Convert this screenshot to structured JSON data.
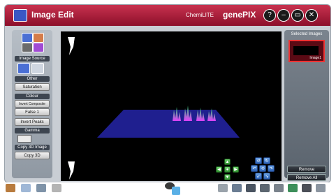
{
  "window": {
    "title": "Image Edit",
    "chemi_label": "ChemiLITE",
    "brand": "genePIX",
    "buttons": [
      "?",
      "–",
      "▭",
      "✕"
    ]
  },
  "left_panel": {
    "image_source_label": "Image Source",
    "other_label": "Other",
    "saturation_label": "Saturation",
    "colour_label": "Colour",
    "invert_composite_label": "Invert Composite",
    "false_label": "False 1",
    "invert_peaks_label": "Invert Peaks",
    "gamma_label": "Gamma",
    "copy3d_section_label": "Copy 3D Image",
    "copy3d_button_label": "Copy 3D"
  },
  "right_panel": {
    "selected_images_label": "Selected Images",
    "thumbnail_caption": "Image1",
    "remove_label": "Remove",
    "remove_all_label": "Remove All"
  },
  "colors": {
    "titlebar": "#b0213e",
    "viewport_bg": "#000000",
    "plane": "#1f1f8f",
    "peaks_top": "#2ecc71",
    "peaks_bottom": "#e040fb"
  },
  "icons": [
    "image-source-icon",
    "zoom-icon",
    "rotate-icon",
    "home-icon",
    "taskbar-icon"
  ]
}
